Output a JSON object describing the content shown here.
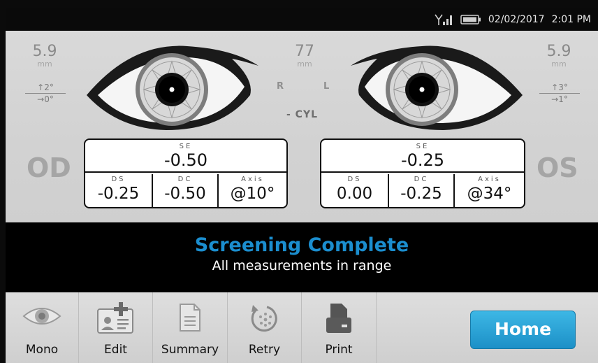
{
  "status": {
    "date": "02/02/2017",
    "time": "2:01 PM",
    "icons": [
      "signal-icon",
      "battery-icon"
    ]
  },
  "measurements": {
    "pupil_left": {
      "value": "5.9",
      "unit": "mm"
    },
    "pupil_right": {
      "value": "5.9",
      "unit": "mm"
    },
    "pd": {
      "value": "77",
      "unit": "mm"
    },
    "gaze_right_eye": {
      "vertical": "↑2°",
      "horizontal": "→0°"
    },
    "gaze_left_eye": {
      "vertical": "↑3°",
      "horizontal": "→1°"
    },
    "orientation_r": "R",
    "orientation_l": "L",
    "cyl_label": "- CYL"
  },
  "od": {
    "label": "OD",
    "se_caption": "SE",
    "se": "-0.50",
    "ds_caption": "DS",
    "ds": "-0.25",
    "dc_caption": "DC",
    "dc": "-0.50",
    "axis_caption": "Axis",
    "axis": "@10°"
  },
  "os": {
    "label": "OS",
    "se_caption": "SE",
    "se": "-0.25",
    "ds_caption": "DS",
    "ds": "0.00",
    "dc_caption": "DC",
    "dc": "-0.25",
    "axis_caption": "Axis",
    "axis": "@34°"
  },
  "message": {
    "title": "Screening Complete",
    "subtitle": "All measurements in range"
  },
  "toolbar": {
    "mono": "Mono",
    "edit": "Edit",
    "summary": "Summary",
    "retry": "Retry",
    "print": "Print",
    "home": "Home"
  },
  "colors": {
    "accent": "#1b8ecf",
    "home_button": "#2aa3d8",
    "background": "#d5d5d5"
  }
}
